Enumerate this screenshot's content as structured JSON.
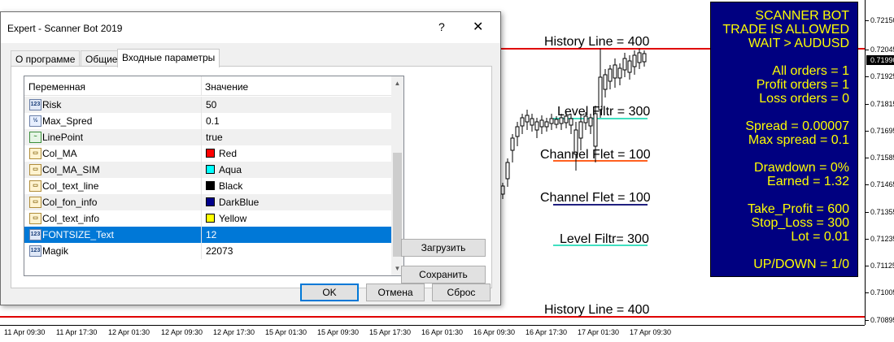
{
  "chart": {
    "labels": {
      "history_line_top": "History Line = 400",
      "level_filtr_top": "Level Filtr = 300",
      "channel_flet_top": "Channel Flet = 100",
      "channel_flet_bottom": "Channel Flet = 100",
      "level_filtr_bottom": "Level Filtr= 300",
      "history_line_bottom": "History Line = 400"
    },
    "price_axis": [
      "0.72150",
      "0.72045",
      "0.71925",
      "0.71815",
      "0.71695",
      "0.71585",
      "0.71465",
      "0.71355",
      "0.71235",
      "0.71125",
      "0.71005",
      "0.70895"
    ],
    "current_price": "0.71990",
    "time_axis": [
      "11 Apr 09:30",
      "11 Apr 17:30",
      "12 Apr 01:30",
      "12 Apr 09:30",
      "12 Apr 17:30",
      "15 Apr 01:30",
      "15 Apr 09:30",
      "15 Apr 17:30",
      "16 Apr 01:30",
      "16 Apr 09:30",
      "16 Apr 17:30",
      "17 Apr 01:30",
      "17 Apr 09:30"
    ],
    "colors": {
      "history_line": "#e00000",
      "level_filtr_top": "#40e0c0",
      "channel_flet_top": "#ff6020",
      "channel_flet_bottom": "#202080",
      "level_filtr_bottom": "#40e0c0"
    }
  },
  "info_panel": {
    "lines": [
      "SCANNER BOT",
      "TRADE IS ALLOWED",
      "WAIT > AUDUSD",
      "",
      "All orders = 1",
      "Profit orders = 1",
      "Loss orders = 0",
      "",
      "Spread =  0.00007",
      "Max spread =  0.1",
      "",
      "Drawdown  = 0%",
      "Earned = 1.32",
      "",
      "Take_Profit = 600",
      "Stop_Loss = 300",
      "Lot = 0.01",
      "",
      "UP/DOWN = 1/0"
    ],
    "bg_color": "#000080",
    "text_color": "#ffff00"
  },
  "dialog": {
    "title": "Expert - Scanner Bot  2019",
    "help_glyph": "?",
    "close_glyph": "✕",
    "tabs": [
      "О программе",
      "Общие",
      "Входные параметры"
    ],
    "active_tab": 2,
    "grid": {
      "col_variable": "Переменная",
      "col_value": "Значение",
      "rows": [
        {
          "icon": "123",
          "name": "Risk",
          "value": "50"
        },
        {
          "icon": "1/2",
          "name": "Max_Spred",
          "value": "0.1"
        },
        {
          "icon": "line",
          "name": "LinePoint",
          "value": "true"
        },
        {
          "icon": "color",
          "name": "Col_MA",
          "value": "Red",
          "swatch": "#ff0000"
        },
        {
          "icon": "color",
          "name": "Col_MA_SIM",
          "value": "Aqua",
          "swatch": "#00ffff"
        },
        {
          "icon": "color",
          "name": "Col_text_line",
          "value": "Black",
          "swatch": "#000000"
        },
        {
          "icon": "color",
          "name": "Col_fon_info",
          "value": "DarkBlue",
          "swatch": "#00008b"
        },
        {
          "icon": "color",
          "name": "Col_text_info",
          "value": "Yellow",
          "swatch": "#ffff00"
        },
        {
          "icon": "123",
          "name": "FONTSIZE_Text",
          "value": "12",
          "selected": true
        },
        {
          "icon": "123",
          "name": "Magik",
          "value": "22073"
        }
      ]
    },
    "buttons": {
      "load": "Загрузить",
      "save": "Сохранить",
      "ok": "OK",
      "cancel": "Отмена",
      "reset": "Сброс"
    }
  }
}
